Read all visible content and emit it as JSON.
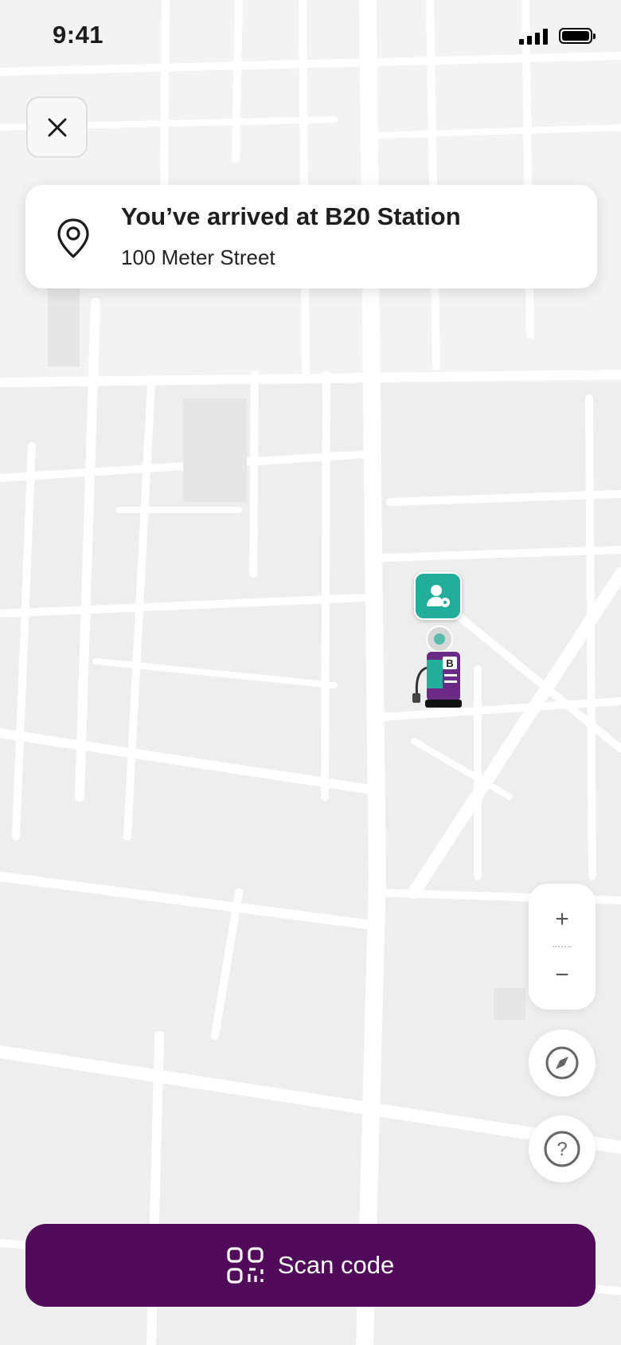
{
  "status_bar": {
    "time": "9:41"
  },
  "arrival": {
    "title": "You’ve arrived at B20 Station",
    "address": "100 Meter Street"
  },
  "icons": {
    "close": "close-icon",
    "location": "map-pin-icon",
    "user_location": "user-location-icon",
    "station": "charging-station-icon",
    "compass": "compass-icon",
    "help": "help-icon",
    "scan": "qr-scan-icon"
  },
  "map_controls": {
    "zoom_in": "+",
    "zoom_out": "−"
  },
  "help": {
    "glyph": "?"
  },
  "station_badge": {
    "letter": "B"
  },
  "scan_button": {
    "label": "Scan code"
  },
  "colors": {
    "primary": "#510a5a",
    "accent": "#22ae9b",
    "map_bg": "#efefef",
    "road": "#ffffff"
  }
}
